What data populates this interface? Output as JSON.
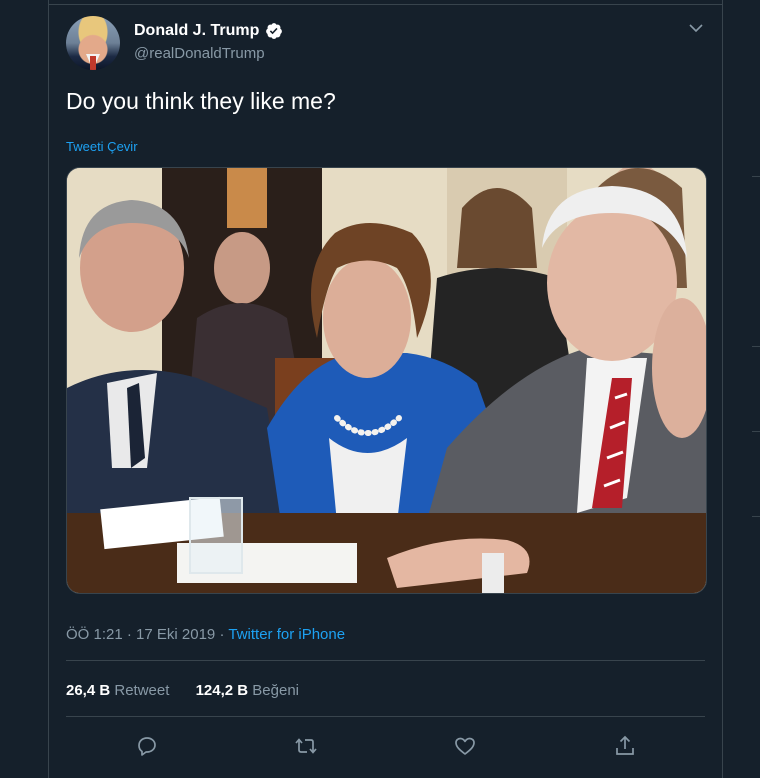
{
  "tweet": {
    "author_name": "Donald J. Trump",
    "handle": "@realDonaldTrump",
    "text": "Do you think they like me?",
    "translate_label": "Tweeti Çevir",
    "time": "ÖÖ 1:21",
    "date": "17 Eki 2019",
    "separator": "·",
    "source": "Twitter for iPhone"
  },
  "stats": {
    "retweets_count": "26,4 B",
    "retweets_label": "Retweet",
    "likes_count": "124,2 B",
    "likes_label": "Beğeni"
  },
  "icons": {
    "verified": "verified-badge-icon",
    "more": "chevron-down-icon",
    "reply": "reply-icon",
    "retweet": "retweet-icon",
    "like": "heart-icon",
    "share": "share-icon"
  },
  "colors": {
    "background": "#15202b",
    "border": "#38444d",
    "accent": "#1da1f2",
    "secondary_text": "#8899a6"
  }
}
